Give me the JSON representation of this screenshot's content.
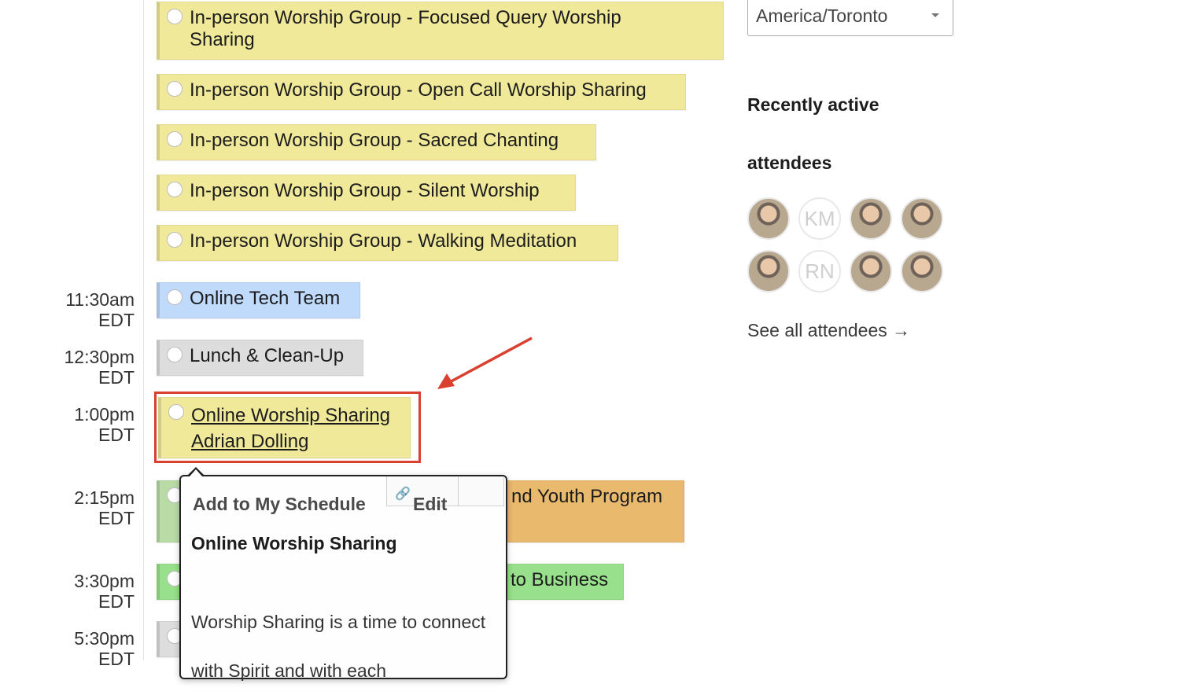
{
  "schedule": {
    "events_top": [
      {
        "title": "In-person Worship Group - Focused Query Worship",
        "title_line2": "Sharing"
      },
      {
        "title": "In-person Worship Group - Open Call Worship Sharing"
      },
      {
        "title": "In-person Worship Group - Sacred Chanting"
      },
      {
        "title": "In-person Worship Group - Silent Worship"
      },
      {
        "title": "In-person Worship Group - Walking Meditation"
      }
    ],
    "slots": [
      {
        "time": "11:30am",
        "tz": "EDT",
        "event": "Online Tech Team"
      },
      {
        "time": "12:30pm",
        "tz": "EDT",
        "event": "Lunch & Clean-Up"
      },
      {
        "time": "1:00pm",
        "tz": "EDT",
        "event": "Online Worship Sharing",
        "speaker": "Adrian Dolling"
      },
      {
        "time": "2:15pm",
        "tz": "EDT",
        "event_partial": "nd Youth Program"
      },
      {
        "time": "3:30pm",
        "tz": "EDT",
        "event_partial": "to Business"
      },
      {
        "time": "5:30pm",
        "tz": "EDT"
      }
    ]
  },
  "popup": {
    "add_label": "Add to My Schedule",
    "edit_label": "Edit",
    "title": "Online Worship Sharing",
    "description": "Worship Sharing is a time to connect with Spirit and with each"
  },
  "sidebar": {
    "timezone": "America/Toronto",
    "recently_active_heading_line1": "Recently active",
    "recently_active_heading_line2": "attendees",
    "avatar_initials": [
      "KM",
      "RN"
    ],
    "see_all": "See all attendees →"
  },
  "colors": {
    "in_person": "#f0e99a",
    "tech_team": "#c0dafc",
    "lunch": "#dddddd",
    "youth": "#e9b96e",
    "business": "#98e08b",
    "highlight_box": "#d94030"
  }
}
